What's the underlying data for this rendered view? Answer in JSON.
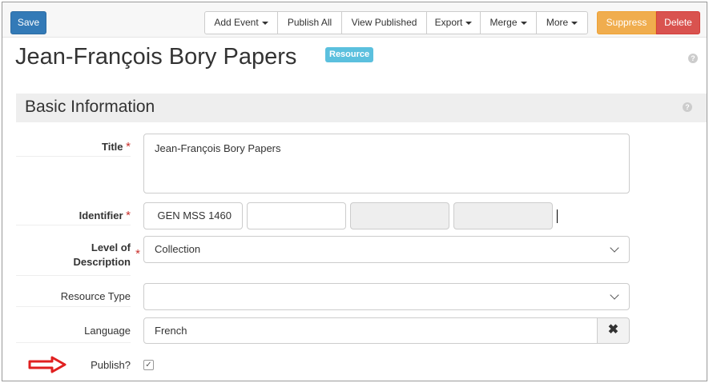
{
  "toolbar": {
    "save": "Save",
    "add_event": "Add Event",
    "publish_all": "Publish All",
    "view_published": "View Published",
    "export": "Export",
    "merge": "Merge",
    "more": "More",
    "suppress": "Suppress",
    "delete": "Delete"
  },
  "header": {
    "title": "Jean-François Bory Papers",
    "badge": "Resource"
  },
  "section": {
    "title": "Basic Information"
  },
  "form": {
    "required_marker": "*",
    "title": {
      "label": "Title",
      "value": "Jean-François Bory Papers"
    },
    "identifier": {
      "label": "Identifier",
      "parts": [
        "GEN MSS 1460",
        "",
        "",
        ""
      ]
    },
    "level": {
      "label_line1": "Level of",
      "label_line2": "Description",
      "value": "Collection"
    },
    "resource_type": {
      "label": "Resource Type",
      "value": ""
    },
    "language": {
      "label": "Language",
      "value": "French"
    },
    "publish": {
      "label": "Publish?",
      "checked": true
    }
  },
  "colors": {
    "primary": "#337ab7",
    "warning": "#f0ad4e",
    "danger": "#d9534f",
    "info": "#5bc0de",
    "required": "#c9302c",
    "arrow": "#e02020"
  }
}
